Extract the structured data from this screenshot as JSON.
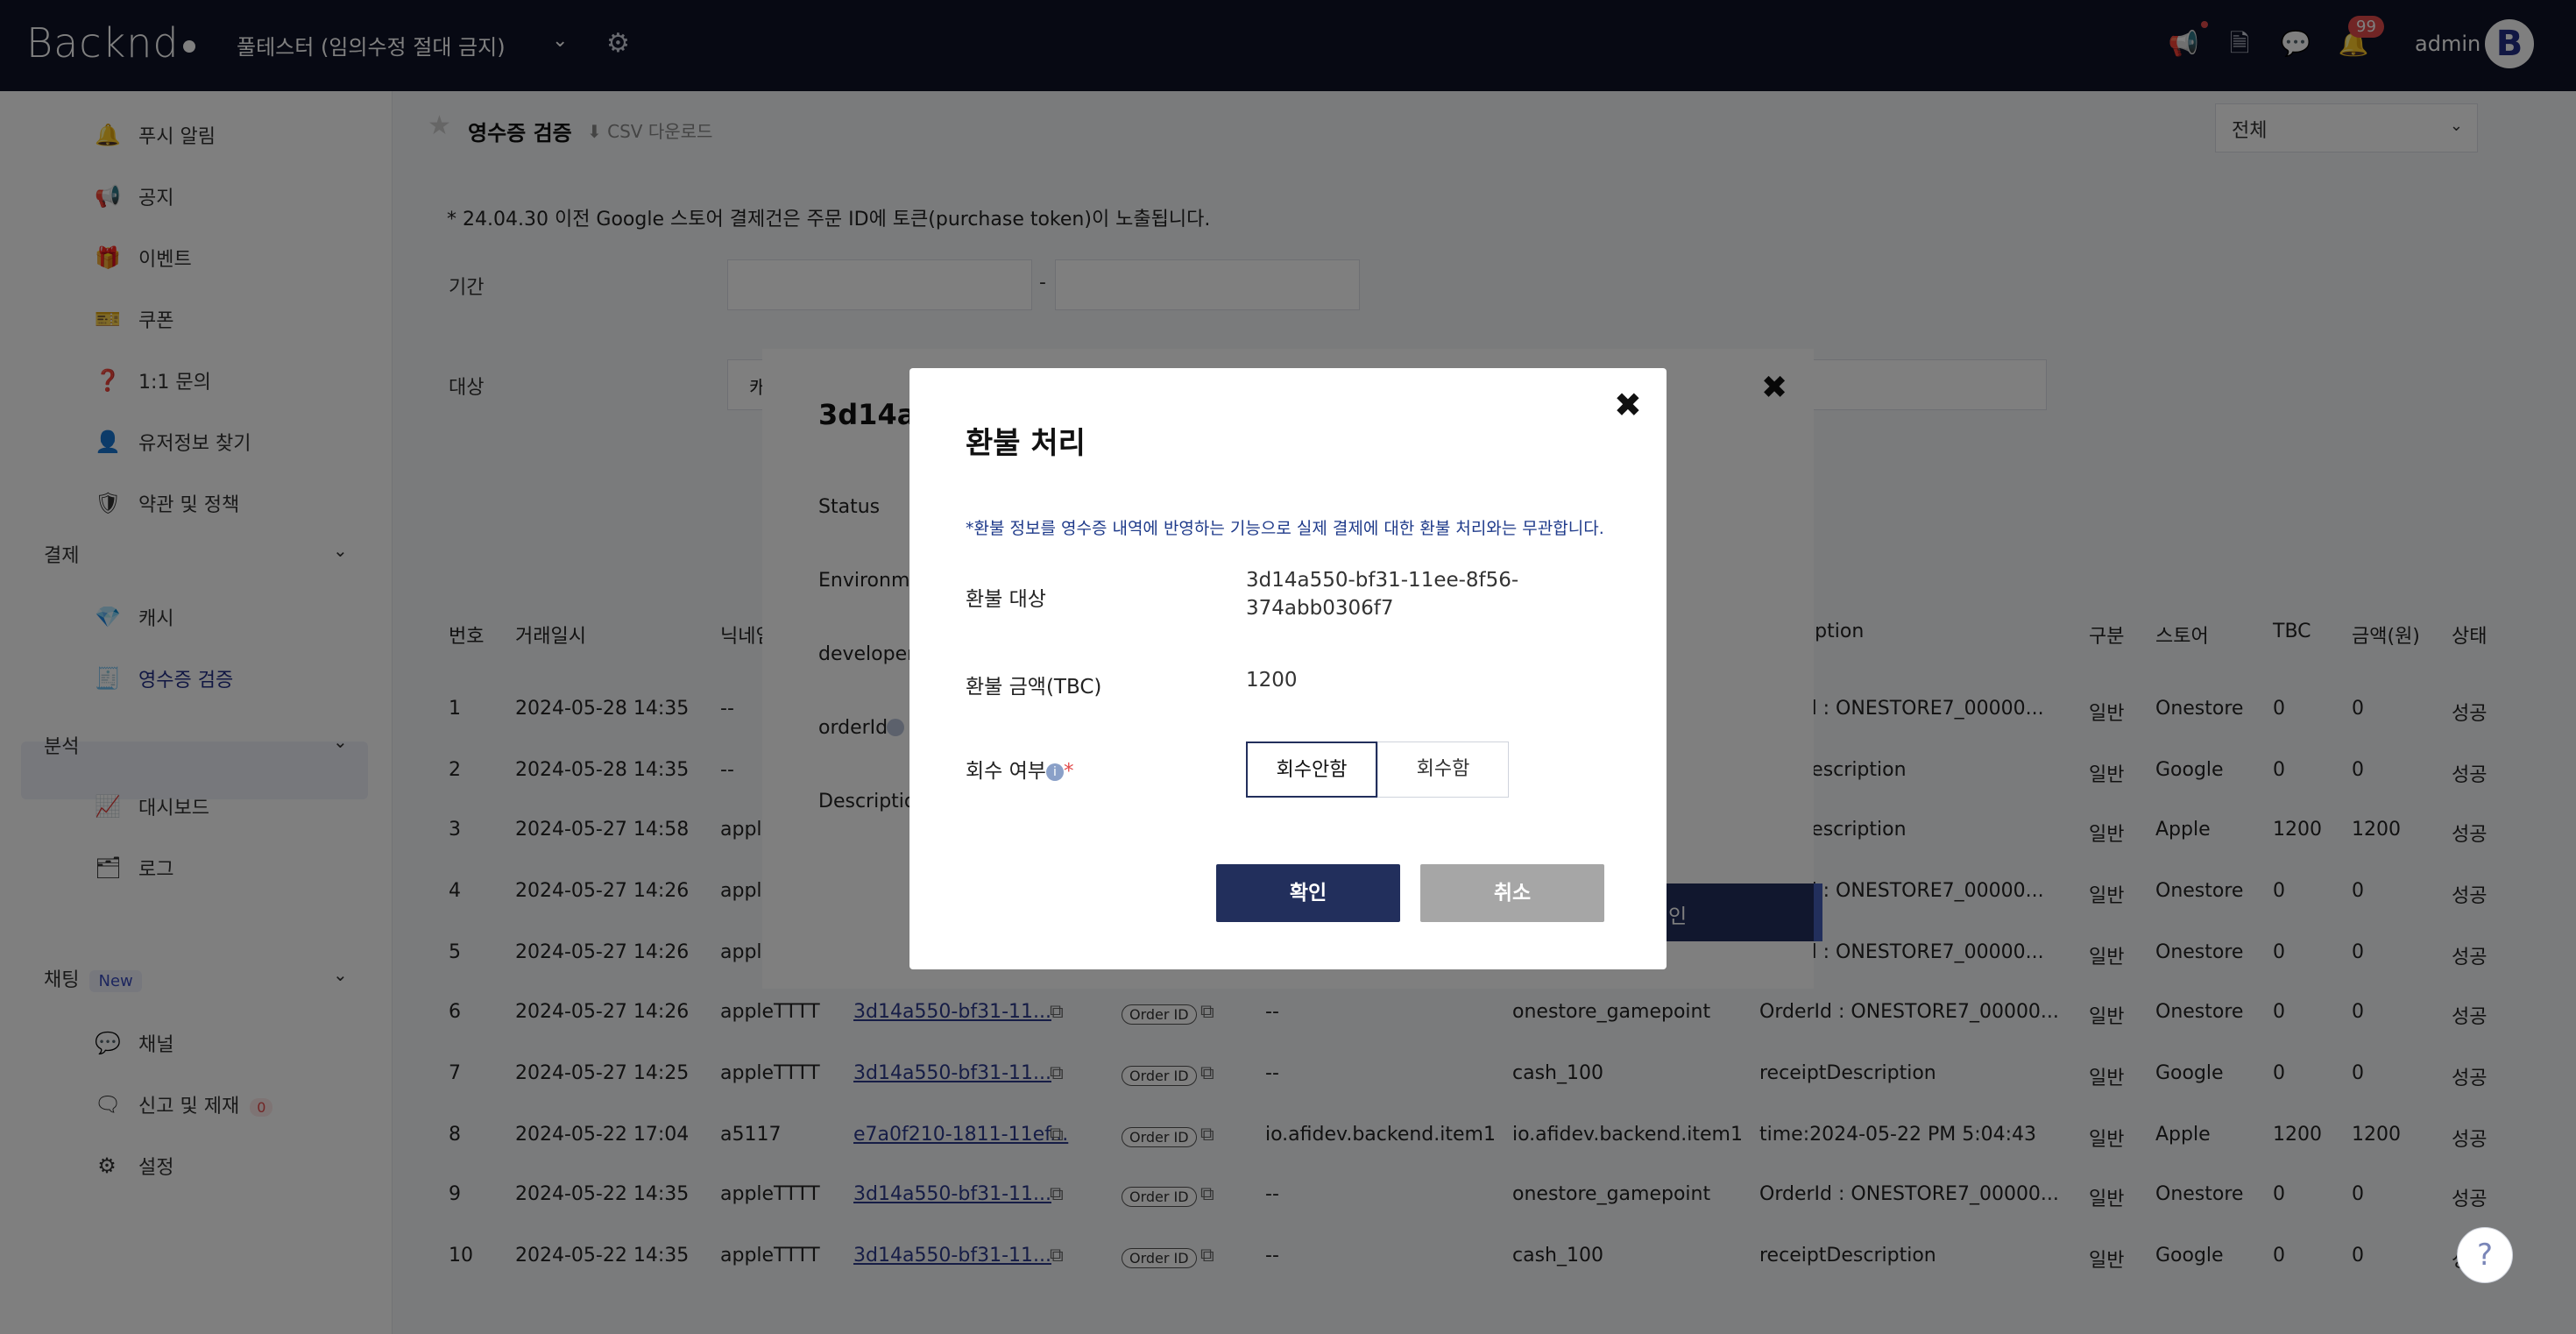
{
  "topbar": {
    "logo": "Backnd",
    "project": "풀테스터 (임의수정 절대 금지)",
    "notif_count": "99",
    "user": "admin",
    "avatar_letter": "B"
  },
  "sidebar": {
    "items_top": [
      {
        "label": "푸시 알림",
        "icon": "bell-icon"
      },
      {
        "label": "공지",
        "icon": "megaphone-icon"
      },
      {
        "label": "이벤트",
        "icon": "gift-icon"
      },
      {
        "label": "쿠폰",
        "icon": "ticket-icon"
      },
      {
        "label": "1:1 문의",
        "icon": "question-icon"
      },
      {
        "label": "유저정보 찾기",
        "icon": "user-search-icon"
      },
      {
        "label": "약관 및 정책",
        "icon": "shield-icon"
      }
    ],
    "section_payment": "결제",
    "items_payment": [
      {
        "label": "캐시",
        "icon": "gem-icon"
      },
      {
        "label": "영수증 검증",
        "icon": "receipt-icon"
      }
    ],
    "section_analytics": "분석",
    "items_analytics": [
      {
        "label": "대시보드",
        "icon": "chart-line-icon"
      },
      {
        "label": "로그",
        "icon": "log-icon"
      }
    ],
    "section_chat": "채팅",
    "chat_new_badge": "New",
    "items_chat": [
      {
        "label": "채널",
        "icon": "chat-bubble-icon"
      },
      {
        "label": "신고 및 제재",
        "icon": "report-icon",
        "badge": "0"
      },
      {
        "label": "설정",
        "icon": "settings-icon"
      }
    ]
  },
  "page": {
    "title": "영수증 검증",
    "csv_label": "CSV 다운로드",
    "filter_value": "전체",
    "note": "* 24.04.30 이전 Google 스토어 결제건은 주문 ID에 토큰(purchase token)이 노출됩니다.",
    "period_label": "기간",
    "period_sep": "-",
    "target_label": "대상",
    "target_prefix": "캐"
  },
  "table": {
    "headers": [
      "번호",
      "거래일시",
      "닉네임",
      "ription",
      "구분",
      "스토어",
      "TBC",
      "금액(원)",
      "상태"
    ],
    "rows": [
      {
        "no": "1",
        "date": "2024-05-28 14:35",
        "nick": "--",
        "uuid": "",
        "pid": "",
        "desc": "rderId : ONESTORE7_00000...",
        "type": "일반",
        "store": "Onestore",
        "tbc": "0",
        "amount": "0",
        "status": "성공"
      },
      {
        "no": "2",
        "date": "2024-05-28 14:35",
        "nick": "--",
        "uuid": "",
        "pid": "",
        "desc": "eiptDescription",
        "type": "일반",
        "store": "Google",
        "tbc": "0",
        "amount": "0",
        "status": "성공"
      },
      {
        "no": "3",
        "date": "2024-05-27 14:58",
        "nick": "apple",
        "uuid": "",
        "pid": "",
        "desc": "eiptDescription",
        "type": "일반",
        "store": "Apple",
        "tbc": "1200",
        "amount": "1200",
        "status": "성공"
      },
      {
        "no": "4",
        "date": "2024-05-27 14:26",
        "nick": "apple",
        "uuid": "",
        "pid": "",
        "desc": "rderId : ONESTORE7_00000...",
        "type": "일반",
        "store": "Onestore",
        "tbc": "0",
        "amount": "0",
        "status": "성공"
      },
      {
        "no": "5",
        "date": "2024-05-27 14:26",
        "nick": "apple",
        "uuid": "",
        "pid": "",
        "desc": "rderId : ONESTORE7_00000...",
        "type": "일반",
        "store": "Onestore",
        "tbc": "0",
        "amount": "0",
        "status": "성공"
      },
      {
        "no": "6",
        "date": "2024-05-27 14:26",
        "nick": "appleTTTT",
        "uuid": "3d14a550-bf31-11...",
        "order": "Order ID",
        "pid": "--",
        "item": "onestore_gamepoint",
        "desc": "OrderId : ONESTORE7_00000...",
        "type": "일반",
        "store": "Onestore",
        "tbc": "0",
        "amount": "0",
        "status": "성공"
      },
      {
        "no": "7",
        "date": "2024-05-27 14:25",
        "nick": "appleTTTT",
        "uuid": "3d14a550-bf31-11...",
        "order": "Order ID",
        "pid": "--",
        "item": "cash_100",
        "desc": "receiptDescription",
        "type": "일반",
        "store": "Google",
        "tbc": "0",
        "amount": "0",
        "status": "성공"
      },
      {
        "no": "8",
        "date": "2024-05-22 17:04",
        "nick": "a5117",
        "uuid": "e7a0f210-1811-11ef...",
        "order": "Order ID",
        "pid": "io.afidev.backend.item1",
        "item": "io.afidev.backend.item1",
        "desc": "time:2024-05-22 PM 5:04:43",
        "type": "일반",
        "store": "Apple",
        "tbc": "1200",
        "amount": "1200",
        "status": "성공"
      },
      {
        "no": "9",
        "date": "2024-05-22 14:35",
        "nick": "appleTTTT",
        "uuid": "3d14a550-bf31-11...",
        "order": "Order ID",
        "pid": "--",
        "item": "onestore_gamepoint",
        "desc": "OrderId : ONESTORE7_00000...",
        "type": "일반",
        "store": "Onestore",
        "tbc": "0",
        "amount": "0",
        "status": "성공"
      },
      {
        "no": "10",
        "date": "2024-05-22 14:35",
        "nick": "appleTTTT",
        "uuid": "3d14a550-bf31-11...",
        "order": "Order ID",
        "pid": "--",
        "item": "cash_100",
        "desc": "receiptDescription",
        "type": "일반",
        "store": "Google",
        "tbc": "0",
        "amount": "0",
        "status": "성공"
      }
    ]
  },
  "detail_modal": {
    "title": "3d14a5",
    "labels": [
      "Status",
      "Environme",
      "developerP",
      "orderId",
      "Description"
    ],
    "btn_label": "인"
  },
  "refund_modal": {
    "title": "환불 처리",
    "note": "*환불 정보를 영수증 내역에 반영하는 기능으로 실제 결제에 대한 환불 처리와는 무관합니다.",
    "target_label": "환불 대상",
    "target_value_1": "3d14a550-bf31-11ee-8f56-",
    "target_value_2": "374abb0306f7",
    "amount_label": "환불 금액(TBC)",
    "amount_value": "1200",
    "recover_label": "회수 여부",
    "recover_required": "*",
    "recover_options": [
      "회수안함",
      "회수함"
    ],
    "confirm": "확인",
    "cancel": "취소"
  },
  "help_label": "?"
}
